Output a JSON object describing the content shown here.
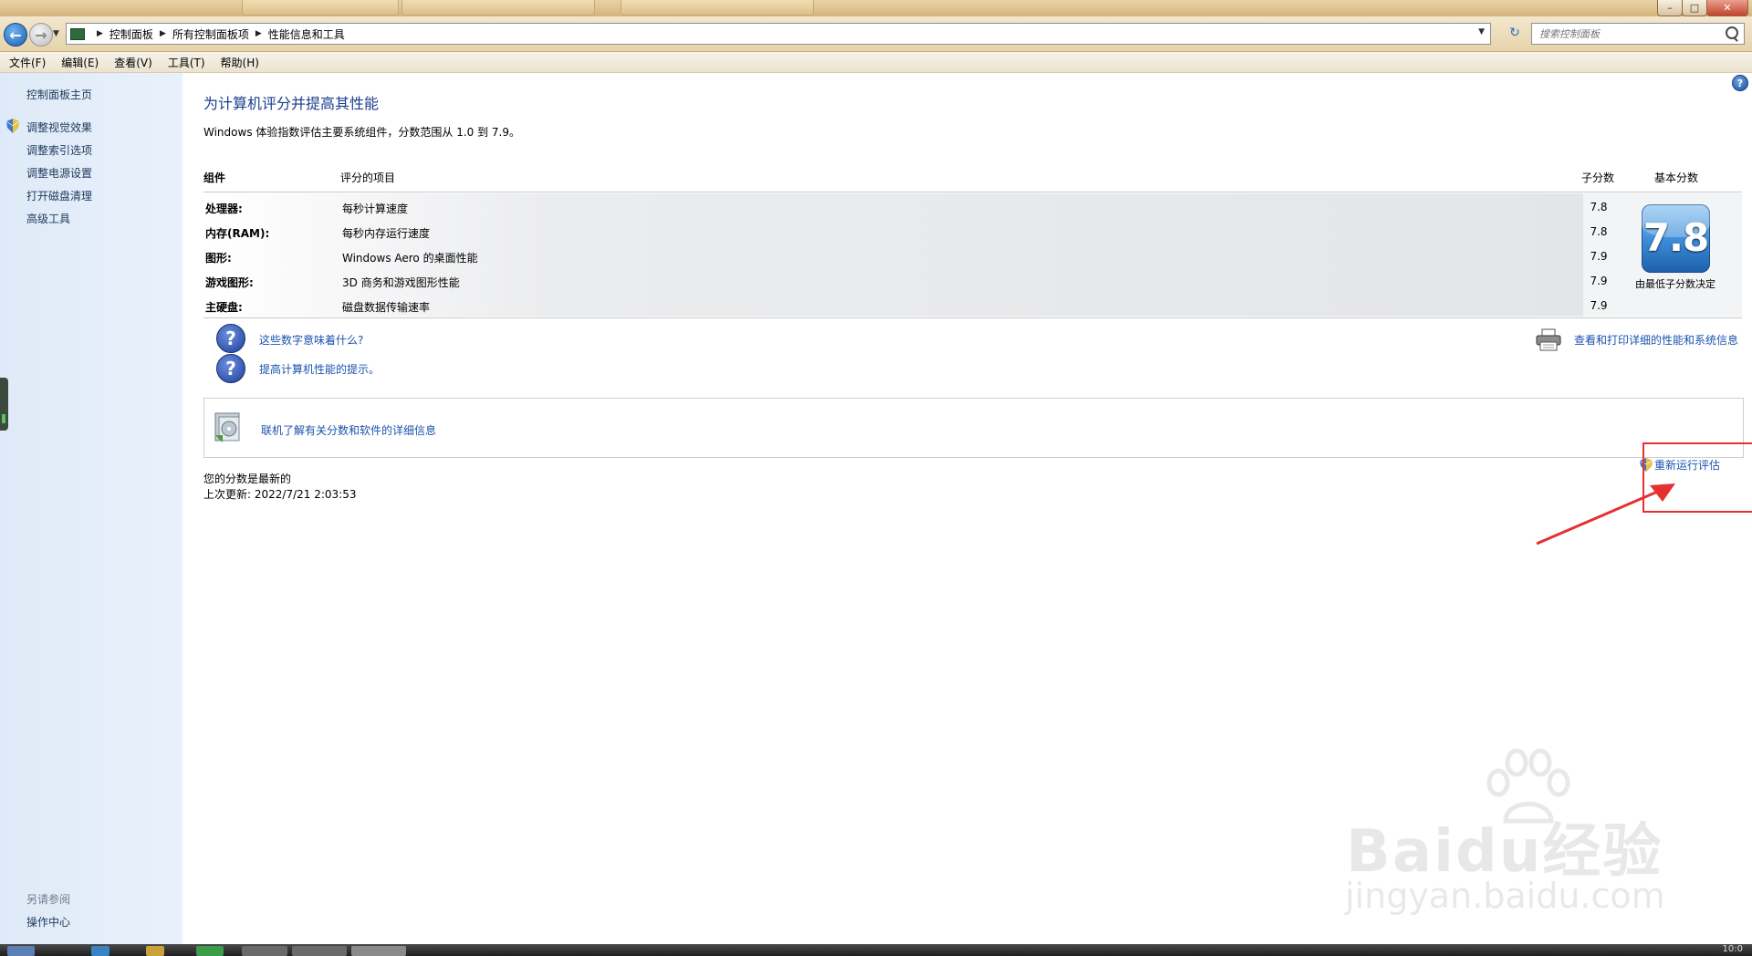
{
  "window": {
    "minimize": "–",
    "maximize": "□",
    "close": "✕"
  },
  "address": {
    "breadcrumb": [
      "控制面板",
      "所有控制面板项",
      "性能信息和工具"
    ],
    "search_placeholder": "搜索控制面板"
  },
  "menu": [
    "文件(F)",
    "编辑(E)",
    "查看(V)",
    "工具(T)",
    "帮助(H)"
  ],
  "sidebar": {
    "home": "控制面板主页",
    "items": [
      "调整视觉效果",
      "调整索引选项",
      "调整电源设置",
      "打开磁盘清理",
      "高级工具"
    ],
    "see_also_title": "另请参阅",
    "see_also_items": [
      "操作中心"
    ]
  },
  "main": {
    "help_symbol": "?",
    "title": "为计算机评分并提高其性能",
    "intro": "Windows 体验指数评估主要系统组件，分数范围从 1.0 到 7.9。",
    "table": {
      "headers": {
        "component": "组件",
        "rated": "评分的项目",
        "subscore": "子分数",
        "base": "基本分数"
      },
      "rows": [
        {
          "component": "处理器:",
          "desc": "每秒计算速度",
          "score": "7.8"
        },
        {
          "component": "内存(RAM):",
          "desc": "每秒内存运行速度",
          "score": "7.8"
        },
        {
          "component": "图形:",
          "desc": "Windows Aero 的桌面性能",
          "score": "7.9"
        },
        {
          "component": "游戏图形:",
          "desc": "3D 商务和游戏图形性能",
          "score": "7.9"
        },
        {
          "component": "主硬盘:",
          "desc": "磁盘数据传输速率",
          "score": "7.9"
        }
      ],
      "base_score": "7.8",
      "base_caption": "由最低子分数决定"
    },
    "links": {
      "what_mean": "这些数字意味着什么?",
      "tips": "提高计算机性能的提示。",
      "print_details": "查看和打印详细的性能和系统信息",
      "online": "联机了解有关分数和软件的详细信息",
      "rerun": "重新运行评估"
    },
    "status": {
      "current": "您的分数是最新的",
      "last_update": "上次更新: 2022/7/21 2:03:53"
    }
  },
  "watermark": {
    "brand": "Baidu经验",
    "url": "jingyan.baidu.com"
  },
  "taskbar": {
    "clock": "10:0"
  },
  "colors": {
    "link": "#1b53ad",
    "title": "#1a3e8c",
    "highlight": "#e53030",
    "sidebar_bg": "#e3edf9"
  }
}
